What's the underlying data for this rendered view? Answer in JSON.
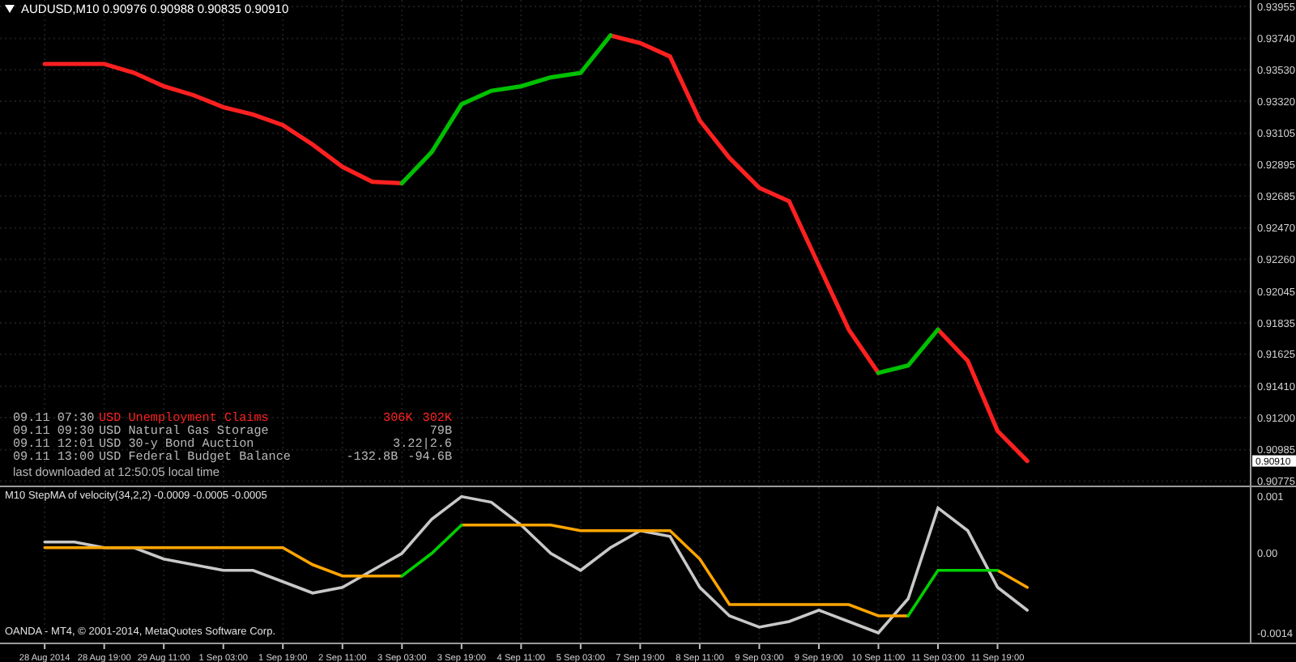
{
  "title": "AUDUSD,M10  0.90976 0.90988 0.90835 0.90910",
  "main_chart": {
    "chart_data": {
      "type": "line",
      "ylim": [
        0.90745,
        0.93998
      ],
      "categories": [
        null,
        null,
        null,
        null,
        null,
        null,
        null,
        null,
        null,
        null,
        null,
        null,
        null,
        null,
        null,
        null,
        null,
        null,
        null,
        null,
        null,
        null,
        null,
        null,
        null,
        null,
        null,
        null,
        null,
        null,
        null,
        null,
        null,
        null,
        null,
        null,
        null,
        null,
        null,
        null,
        null,
        null
      ],
      "series": [
        {
          "color": "#ff2020",
          "values": [
            null,
            0.9357,
            0.9357,
            0.9357,
            0.9351,
            0.9342,
            0.9336,
            0.9328,
            0.9323,
            0.9316,
            0.9303,
            0.9288,
            0.9278,
            0.9277,
            null,
            null,
            null,
            null,
            null,
            null,
            0.9376,
            0.9371,
            0.9362,
            0.9319,
            0.9294,
            0.9274,
            0.9265,
            0.9222,
            0.9179,
            0.915,
            null,
            0.9179,
            0.9158,
            0.9111,
            0.9091,
            null,
            null,
            null,
            null,
            null,
            null,
            null
          ]
        },
        {
          "color": "#00c000",
          "values": [
            null,
            null,
            null,
            null,
            null,
            null,
            null,
            null,
            null,
            null,
            null,
            null,
            null,
            0.9277,
            0.9298,
            0.933,
            0.9339,
            0.9342,
            0.9348,
            0.9351,
            0.9376,
            null,
            null,
            null,
            null,
            null,
            null,
            null,
            null,
            0.915,
            0.9155,
            0.9179,
            null,
            null,
            null,
            null,
            null,
            null,
            null,
            null,
            null,
            null
          ]
        }
      ],
      "grid": true,
      "yticks": [
        {
          "value": 0.93955,
          "label": "0.93955"
        },
        {
          "value": 0.9374,
          "label": "0.93740"
        },
        {
          "value": 0.9353,
          "label": "0.93530"
        },
        {
          "value": 0.9332,
          "label": "0.93320"
        },
        {
          "value": 0.93105,
          "label": "0.93105"
        },
        {
          "value": 0.92895,
          "label": "0.92895"
        },
        {
          "value": 0.92685,
          "label": "0.92685"
        },
        {
          "value": 0.9247,
          "label": "0.92470"
        },
        {
          "value": 0.9226,
          "label": "0.92260"
        },
        {
          "value": 0.92045,
          "label": "0.92045"
        },
        {
          "value": 0.91835,
          "label": "0.91835"
        },
        {
          "value": 0.91625,
          "label": "0.91625"
        },
        {
          "value": 0.9141,
          "label": "0.91410"
        },
        {
          "value": 0.912,
          "label": "0.91200"
        },
        {
          "value": 0.90985,
          "label": "0.90985"
        },
        {
          "value": 0.90775,
          "label": "0.90775"
        }
      ],
      "annotations": [
        "0.90910"
      ]
    }
  },
  "news": [
    {
      "time": "09.11 07:30",
      "event": "USD Unemployment Claims",
      "values": [
        "306K",
        "302K"
      ],
      "highlighted": true
    },
    {
      "time": "09.11 09:30",
      "event": "USD Natural Gas Storage",
      "values": [
        "79B"
      ],
      "highlighted": false
    },
    {
      "time": "09.11 12:01",
      "event": "USD 30-y Bond Auction",
      "values": [
        "3.22|2.6"
      ],
      "highlighted": false
    },
    {
      "time": "09.11 13:00",
      "event": "USD Federal Budget Balance",
      "values": [
        "-132.8B",
        "-94.6B"
      ],
      "highlighted": false
    }
  ],
  "news_note": "last downloaded at 12:50:05 local time",
  "indicator": {
    "label": "M10 StepMA of velocity(34,2,2) -0.0009 -0.0005 -0.0005",
    "chart_data": {
      "type": "line",
      "ylim": [
        -0.0016,
        0.001166
      ],
      "categories": [
        null,
        "28 Aug 2014",
        null,
        "28 Aug 19:00",
        null,
        "29 Aug 11:00",
        null,
        "1 Sep 03:00",
        null,
        "1 Sep 19:00",
        null,
        "2 Sep 11:00",
        null,
        "3 Sep 03:00",
        null,
        "3 Sep 19:00",
        null,
        "4 Sep 11:00",
        null,
        "5 Sep 03:00",
        null,
        "7 Sep 19:00",
        null,
        "8 Sep 11:00",
        null,
        "9 Sep 03:00",
        null,
        "9 Sep 19:00",
        null,
        "10 Sep 11:00",
        null,
        "11 Sep 03:00",
        null,
        "11 Sep 19:00",
        null,
        null,
        null,
        null,
        null,
        null,
        null,
        null
      ],
      "series": [
        {
          "color": "#c8c8c8",
          "values": [
            null,
            0.0002,
            0.0002,
            0.0001,
            0.0001,
            -0.0001,
            -0.0002,
            -0.0003,
            -0.0003,
            -0.0005,
            -0.0007,
            -0.0006,
            -0.0003,
            0,
            0.0006,
            0.001,
            0.0009,
            0.0005,
            0,
            -0.0003,
            0.0001,
            0.0004,
            0.0003,
            -0.0006,
            -0.0011,
            -0.0013,
            -0.0012,
            -0.001,
            -0.0012,
            -0.0014,
            -0.0008,
            0.0008,
            0.0004,
            -0.0006,
            -0.001,
            null,
            null,
            null,
            null,
            null,
            null,
            null
          ]
        },
        {
          "color": "#ffa500",
          "values": [
            null,
            0.0001,
            0.0001,
            0.0001,
            0.0001,
            0.0001,
            0.0001,
            0.0001,
            0.0001,
            0.0001,
            -0.0002,
            -0.0004,
            -0.0004,
            -0.0004,
            null,
            0.0005,
            0.0005,
            0.0005,
            0.0005,
            0.0004,
            0.0004,
            0.0004,
            0.0004,
            -0.0001,
            -0.0009,
            -0.0009,
            -0.0009,
            -0.0009,
            -0.0009,
            -0.0011,
            -0.0011,
            null,
            null,
            -0.0003,
            -0.0006,
            null,
            null,
            null,
            null,
            null,
            null,
            null
          ]
        },
        {
          "color": "#00d000",
          "values": [
            null,
            null,
            null,
            null,
            null,
            null,
            null,
            null,
            null,
            null,
            null,
            null,
            null,
            -0.0004,
            0,
            0.0005,
            null,
            null,
            null,
            null,
            null,
            null,
            null,
            null,
            null,
            null,
            null,
            null,
            null,
            null,
            -0.0011,
            -0.0003,
            -0.0003,
            -0.0003,
            null,
            null,
            null,
            null,
            null,
            null,
            null,
            null
          ]
        }
      ],
      "grid": true,
      "yticks": [
        {
          "value": 0.001,
          "label": "0.001"
        },
        {
          "value": 0,
          "label": "0.00"
        },
        {
          "value": -0.0014,
          "label": "-0.0014"
        }
      ]
    }
  },
  "footer": "OANDA - MT4, © 2001-2014, MetaQuotes Software Corp."
}
